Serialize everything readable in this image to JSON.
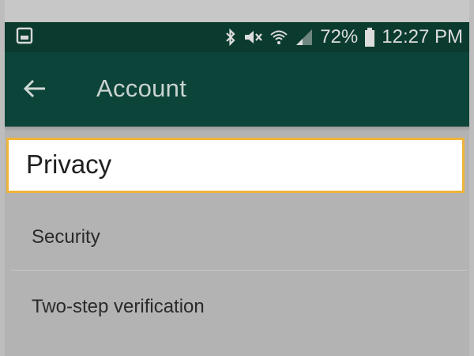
{
  "status_bar": {
    "icons": [
      "image-notification-icon",
      "bluetooth-icon",
      "mute-icon",
      "wifi-icon",
      "signal-icon",
      "battery-icon"
    ],
    "battery_percent": "72%",
    "time": "12:27 PM"
  },
  "app_bar": {
    "title": "Account",
    "back_icon": "arrow-left-icon"
  },
  "menu": {
    "items": [
      {
        "label": "Privacy",
        "highlighted": true
      },
      {
        "label": "Security"
      },
      {
        "label": "Two-step verification"
      }
    ]
  },
  "colors": {
    "status_bar_bg": "#0a3b2e",
    "app_bar_bg": "#0d4439",
    "highlight_border": "#f0b43a",
    "list_bg": "#b3b3b3"
  }
}
